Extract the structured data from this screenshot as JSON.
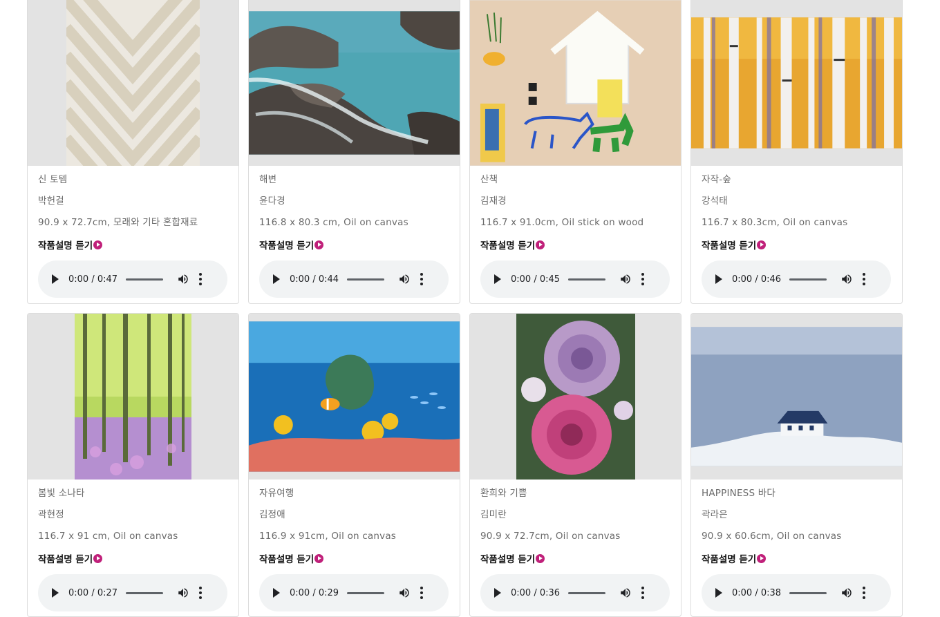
{
  "listen_label": "작품설명 듣기",
  "accent_color": "#c0207a",
  "artworks": [
    {
      "title": "신 토템",
      "artist": "박헌걸",
      "spec": "90.9 x 72.7cm, 모래와 기타 혼합재료",
      "duration": "0:00 / 0:47",
      "image": "diamond-pattern-painting"
    },
    {
      "title": "해변",
      "artist": "윤다경",
      "spec": "116.8 x 80.3 cm, Oil on canvas",
      "duration": "0:00 / 0:44",
      "image": "rocky-sea-painting"
    },
    {
      "title": "산책",
      "artist": "김재경",
      "spec": "116.7 x 91.0cm, Oil stick on wood",
      "duration": "0:00 / 0:45",
      "image": "house-and-animals-painting"
    },
    {
      "title": "자작-숲",
      "artist": "강석태",
      "spec": "116.7 x 80.3cm, Oil on canvas",
      "duration": "0:00 / 0:46",
      "image": "birch-forest-painting"
    },
    {
      "title": "봄빛 소나타",
      "artist": "곽현정",
      "spec": "116.7 x 91 cm, Oil on canvas",
      "duration": "0:00 / 0:27",
      "image": "spring-forest-painting"
    },
    {
      "title": "자유여행",
      "artist": "김정애",
      "spec": "116.9 x 91cm, Oil on canvas",
      "duration": "0:00 / 0:29",
      "image": "coral-reef-painting"
    },
    {
      "title": "환희와 기쁨",
      "artist": "김미란",
      "spec": "90.9 x 72.7cm, Oil on canvas",
      "duration": "0:00 / 0:36",
      "image": "roses-painting"
    },
    {
      "title": "HAPPINESS 바다",
      "artist": "곽라은",
      "spec": "90.9 x 60.6cm, Oil on canvas",
      "duration": "0:00 / 0:38",
      "image": "seaside-house-painting"
    }
  ]
}
